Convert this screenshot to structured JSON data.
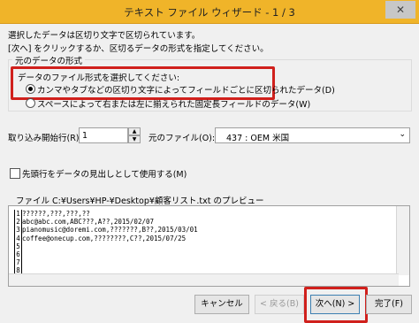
{
  "window": {
    "title": "テキスト ファイル ウィザード - 1 / 3",
    "close_glyph": "✕"
  },
  "intro": {
    "line1": "選択したデータは区切り文字で区切られています。",
    "line2": "[次へ] をクリックするか、区切るデータの形式を指定してください。"
  },
  "format_group": {
    "legend": "元のデータの形式",
    "prompt": "データのファイル形式を選択してください:",
    "delimited_label": "カンマやタブなどの区切り文字によってフィールドごとに区切られたデータ(D)",
    "fixed_label": "スペースによって右または左に揃えられた固定長フィールドのデータ(W)",
    "selected": "delimited"
  },
  "import_row": {
    "label": "取り込み開始行(R):",
    "value": "1",
    "origin_label": "元のファイル(O):",
    "origin_value": "437 : OEM 米国"
  },
  "header_checkbox": {
    "label": "先頭行をデータの見出しとして使用する(M)",
    "checked": false
  },
  "preview": {
    "label": "ファイル C:¥Users¥HP-¥Desktop¥顧客リスト.txt のプレビュー",
    "row_numbers": [
      "1",
      "2",
      "3",
      "4",
      "5",
      "6",
      "7",
      "8",
      "9"
    ],
    "lines": [
      "??????,???,???,??",
      "abc@abc.com,ABC???,A??,2015/02/07",
      "pianomusic@doremi.com,???????,B??,2015/03/01",
      "coffee@onecup.com,????????,C??,2015/07/25",
      "",
      "",
      "",
      "",
      ""
    ]
  },
  "buttons": {
    "cancel": "キャンセル",
    "back": "< 戻る(B)",
    "next": "次へ(N) >",
    "finish": "完了(F)"
  },
  "colors": {
    "titlebar": "#f0b429",
    "highlight": "#d0201c"
  }
}
